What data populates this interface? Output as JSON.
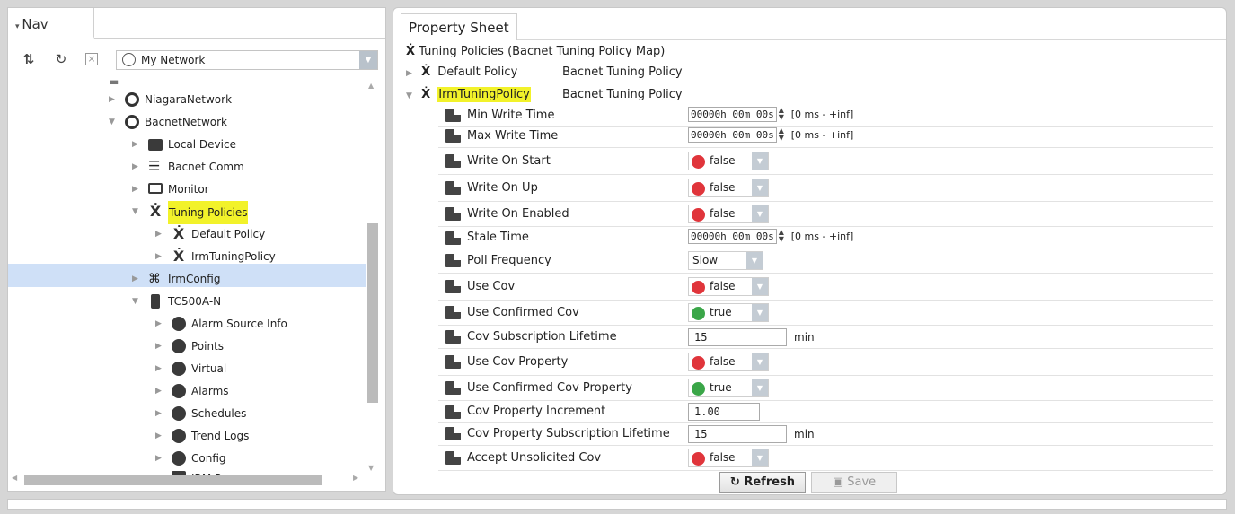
{
  "nav": {
    "tab_label": "Nav",
    "network": "My Network",
    "tree": [
      {
        "label": "NiagaraNetwork",
        "icon": "globe-icon"
      },
      {
        "label": "BacnetNetwork",
        "icon": "globe-icon"
      },
      {
        "label": "Local Device",
        "icon": "device-icon"
      },
      {
        "label": "Bacnet Comm",
        "icon": "comm-icon"
      },
      {
        "label": "Monitor",
        "icon": "monitor-icon"
      },
      {
        "label": "Tuning Policies",
        "icon": "tuning-icon"
      },
      {
        "label": "Default Policy",
        "icon": "tuning-icon"
      },
      {
        "label": "IrmTuningPolicy",
        "icon": "tuning-icon"
      },
      {
        "label": "IrmConfig",
        "icon": "config-icon"
      },
      {
        "label": "TC500A-N",
        "icon": "device-icon"
      },
      {
        "label": "Alarm Source Info",
        "icon": "alarm-icon"
      },
      {
        "label": "Points",
        "icon": "points-icon"
      },
      {
        "label": "Virtual",
        "icon": "virtual-icon"
      },
      {
        "label": "Alarms",
        "icon": "alarm-icon"
      },
      {
        "label": "Schedules",
        "icon": "schedule-icon"
      },
      {
        "label": "Trend Logs",
        "icon": "trend-icon"
      },
      {
        "label": "Config",
        "icon": "config-icon"
      },
      {
        "label": "IRM Program",
        "icon": "program-icon"
      }
    ]
  },
  "sheet": {
    "tab_label": "Property Sheet",
    "root_label": "Tuning Policies  (Bacnet Tuning Policy Map)",
    "default_name": "Default Policy",
    "default_type": "Bacnet Tuning Policy",
    "irm_name": "IrmTuningPolicy",
    "irm_type": "Bacnet Tuning Policy",
    "reltime": "00000h 00m 00s",
    "range": "[0 ms - +inf]",
    "false_text": "false",
    "true_text": "true",
    "poll": "Slow",
    "cov_lifetime": "15",
    "cov_prop_increment": "1.00",
    "cov_prop_lifetime": "15",
    "unit_min": "min",
    "props": [
      "Min Write Time",
      "Max Write Time",
      "Write On Start",
      "Write On Up",
      "Write On Enabled",
      "Stale Time",
      "Poll Frequency",
      "Use Cov",
      "Use Confirmed Cov",
      "Cov Subscription Lifetime",
      "Use Cov Property",
      "Use Confirmed Cov Property",
      "Cov Property Increment",
      "Cov Property Subscription Lifetime",
      "Accept Unsolicited Cov"
    ],
    "refresh_label": "Refresh",
    "save_label": "Save"
  },
  "colors": {
    "false": "#e0353b",
    "true": "#3aa648",
    "highlight": "#f2f22a",
    "selection": "#cfe0f7"
  }
}
